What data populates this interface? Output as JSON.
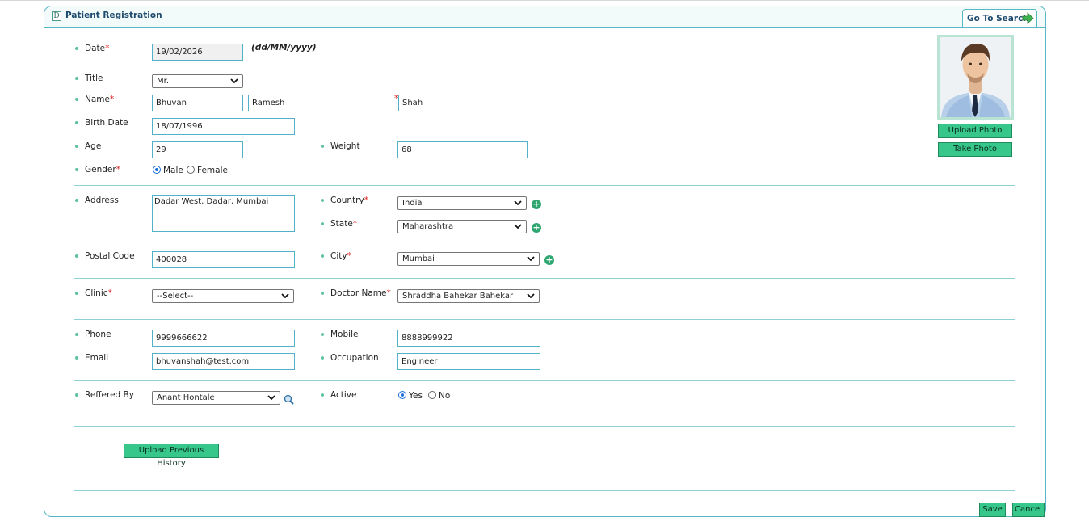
{
  "header": {
    "icon_letter": "D",
    "title": "Patient Registration",
    "go_search_label": "Go To Search"
  },
  "form": {
    "date": {
      "label": "Date",
      "value": "19/02/2026",
      "format_hint": "(dd/MM/yyyy)"
    },
    "title": {
      "label": "Title",
      "value": "Mr."
    },
    "name": {
      "label": "Name",
      "first": "Bhuvan",
      "middle": "Ramesh",
      "last": "Shah"
    },
    "birth_date": {
      "label": "Birth Date",
      "value": "18/07/1996"
    },
    "age": {
      "label": "Age",
      "value": "29"
    },
    "weight": {
      "label": "Weight",
      "value": "68"
    },
    "gender": {
      "label": "Gender",
      "options": [
        "Male",
        "Female"
      ],
      "selected": "Male"
    },
    "address": {
      "label": "Address",
      "value": "Dadar West, Dadar, Mumbai"
    },
    "country": {
      "label": "Country",
      "value": "India"
    },
    "state": {
      "label": "State",
      "value": "Maharashtra"
    },
    "postal_code": {
      "label": "Postal Code",
      "value": "400028"
    },
    "city": {
      "label": "City",
      "value": "Mumbai"
    },
    "clinic": {
      "label": "Clinic",
      "value": "--Select--"
    },
    "doctor": {
      "label": "Doctor Name",
      "value": "Shraddha Bahekar Bahekar"
    },
    "phone": {
      "label": "Phone",
      "value": "9999666622"
    },
    "mobile": {
      "label": "Mobile",
      "value": "8888999922"
    },
    "email": {
      "label": "Email",
      "value": "bhuvanshah@test.com"
    },
    "occupation": {
      "label": "Occupation",
      "value": "Engineer"
    },
    "referred_by": {
      "label": "Reffered By",
      "value": "Anant Hontale"
    },
    "active": {
      "label": "Active",
      "options": [
        "Yes",
        "No"
      ],
      "selected": "Yes"
    }
  },
  "photo": {
    "upload_label": "Upload Photo",
    "take_label": "Take Photo"
  },
  "buttons": {
    "upload_history": "Upload Previous History",
    "save": "Save",
    "cancel": "Cancel"
  },
  "colors": {
    "accent_border": "#57b7c4",
    "button_green": "#37c78a",
    "bullet": "#5ec2a4",
    "required": "#e02020"
  }
}
